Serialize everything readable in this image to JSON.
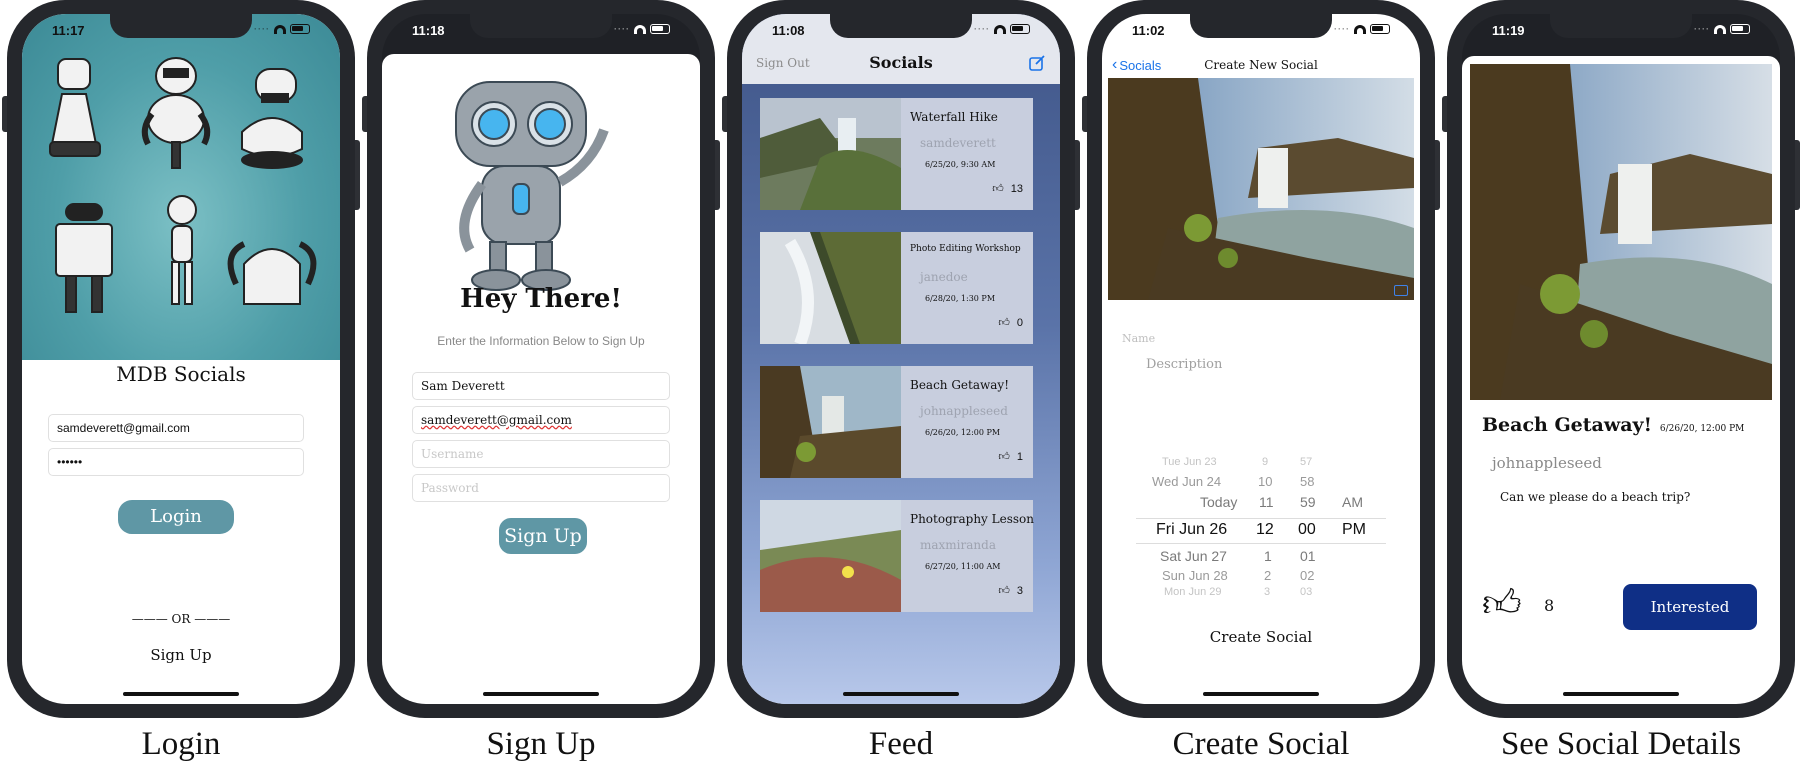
{
  "screens": {
    "login": {
      "status_time": "11:17",
      "app_title": "MDB Socials",
      "email_value": "samdeverett@gmail.com",
      "password_value": "••••••",
      "login_button": "Login",
      "divider": "——— OR ———",
      "signup_link": "Sign Up",
      "caption": "Login"
    },
    "signup": {
      "status_time": "11:18",
      "greeting": "Hey There!",
      "subtitle": "Enter the Information Below to Sign Up",
      "name_value": "Sam Deverett",
      "email_value": "samdeverett@gmail.com",
      "username_placeholder": "Username",
      "password_placeholder": "Password",
      "signup_button": "Sign Up",
      "caption": "Sign Up"
    },
    "feed": {
      "status_time": "11:08",
      "sign_out": "Sign Out",
      "title": "Socials",
      "compose_icon": "compose-icon",
      "posts": [
        {
          "title": "Waterfall Hike",
          "user": "samdeverett",
          "date": "6/25/20, 9:30 AM",
          "likes": "13"
        },
        {
          "title": "Photo Editing Workshop",
          "user": "janedoe",
          "date": "6/28/20, 1:30 PM",
          "likes": "0"
        },
        {
          "title": "Beach Getaway!",
          "user": "johnappleseed",
          "date": "6/26/20, 12:00 PM",
          "likes": "1"
        },
        {
          "title": "Photography Lesson",
          "user": "maxmiranda",
          "date": "6/27/20, 11:00 AM",
          "likes": "3"
        }
      ],
      "caption": "Feed"
    },
    "create": {
      "status_time": "11:02",
      "back_label": "Socials",
      "nav_title": "Create New Social",
      "name_placeholder": "Name",
      "description_placeholder": "Description",
      "picker_rows": [
        {
          "day": "Tue Jun 23",
          "hour": "9",
          "min": "57",
          "ampm": ""
        },
        {
          "day": "Wed Jun 24",
          "hour": "10",
          "min": "58",
          "ampm": ""
        },
        {
          "day": "Today",
          "hour": "11",
          "min": "59",
          "ampm": "AM"
        },
        {
          "day": "Fri Jun 26",
          "hour": "12",
          "min": "00",
          "ampm": "PM"
        },
        {
          "day": "Sat Jun 27",
          "hour": "1",
          "min": "01",
          "ampm": ""
        },
        {
          "day": "Sun Jun 28",
          "hour": "2",
          "min": "02",
          "ampm": ""
        },
        {
          "day": "Mon Jun 29",
          "hour": "3",
          "min": "03",
          "ampm": ""
        }
      ],
      "create_button": "Create Social",
      "caption": "Create Social"
    },
    "details": {
      "status_time": "11:19",
      "title": "Beach Getaway!",
      "date": "6/26/20, 12:00 PM",
      "user": "johnappleseed",
      "description": "Can we please do a beach trip?",
      "likes": "8",
      "interested_button": "Interested",
      "caption": "See Social Details"
    }
  },
  "colors": {
    "teal_button": "#5f97a5",
    "ios_blue": "#1a73e8",
    "interested_blue": "#0f2f86",
    "phone_frame": "#25272c"
  }
}
